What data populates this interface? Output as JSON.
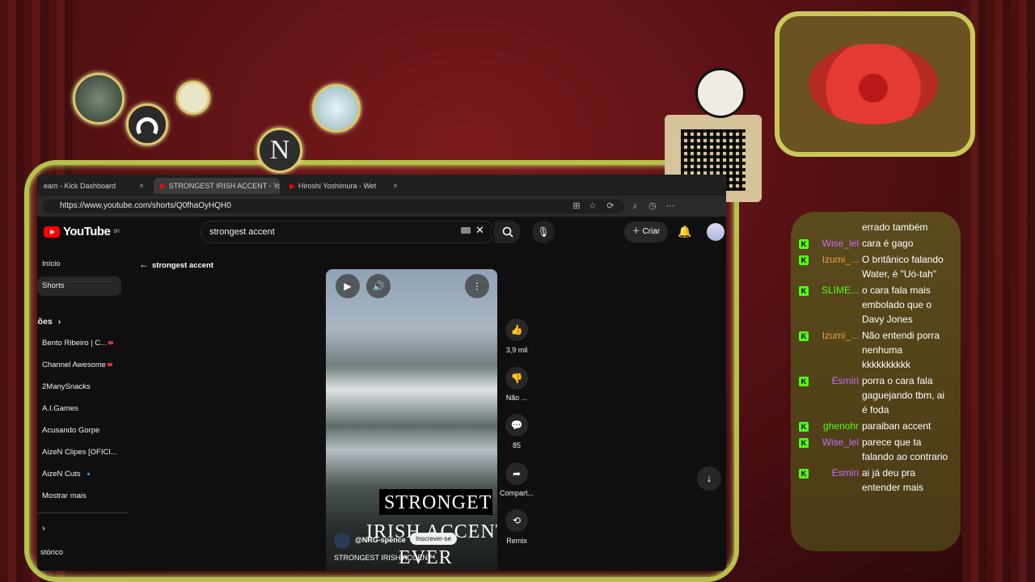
{
  "browser": {
    "tabs": [
      {
        "label": "eam - Kick Dashboard",
        "close": "×"
      },
      {
        "label": "STRONGEST IRISH ACCENT - YouT",
        "close": "×"
      },
      {
        "label": "Hiroshi Yoshimura - Wet",
        "close": "×"
      }
    ],
    "url": "https://www.youtube.com/shorts/Q0fhaOyHQH0"
  },
  "youtube": {
    "logo": "YouTube",
    "region": "BR",
    "search_value": "strongest accent",
    "create_label": "Criar",
    "sidebar": {
      "home": "Início",
      "shorts": "Shorts",
      "subscriptions_header": "crições",
      "channels": [
        {
          "name": "Bento Ribeiro | C...",
          "live": true
        },
        {
          "name": "Channel Awesome",
          "live": true
        },
        {
          "name": "2ManySnacks",
          "live": false
        },
        {
          "name": "A.I.Games",
          "live": false
        },
        {
          "name": "Acusando Gorpe",
          "live": false
        },
        {
          "name": "AizeN Clipes [OFICI...",
          "live": false
        },
        {
          "name": "AizeN Cuts",
          "live": false,
          "new": true
        }
      ],
      "show_more": "Mostrar mais",
      "history": "stórico"
    },
    "back_label": "strongest accent",
    "short": {
      "caption_line1": "STRONGET",
      "caption_line2": "IRISH ACCENT",
      "caption_line3": "EVER",
      "channel": "@NRG-spence",
      "subscribe": "Inscrever-se",
      "title": "STRONGEST IRISH ACCENT"
    },
    "actions": {
      "likes": "3,9 mil",
      "dislike": "Não ...",
      "comments": "85",
      "share": "Compart...",
      "remix": "Remix"
    }
  },
  "chat": [
    {
      "user": "",
      "color": "#ffffff",
      "message": "errado também"
    },
    {
      "user": "Wise_lel",
      "color": "#c86bff",
      "message": "cara é gago"
    },
    {
      "user": "Izumi_...",
      "color": "#e8a24a",
      "message": "O britânico falando Water, é \"Uó-tah\""
    },
    {
      "user": "SLIME...",
      "color": "#53fc18",
      "message": "o cara fala mais embolado que o Davy Jones"
    },
    {
      "user": "Izumi_...",
      "color": "#e8a24a",
      "message": "Não entendi porra nenhuma kkkkkkkkkk"
    },
    {
      "user": "Esmiri",
      "color": "#c86bff",
      "message": "porra o cara fala gaguejando tbm, ai é foda"
    },
    {
      "user": "ghenohr",
      "color": "#53fc18",
      "message": "paraiban accent"
    },
    {
      "user": "Wise_lel",
      "color": "#c86bff",
      "message": "parece que ta falando ao contrario"
    },
    {
      "user": "Esmiri",
      "color": "#c86bff",
      "message": "ai já deu pra entender mais"
    }
  ],
  "overlay": {
    "medal_letter": "N",
    "badge_letter": "K"
  }
}
